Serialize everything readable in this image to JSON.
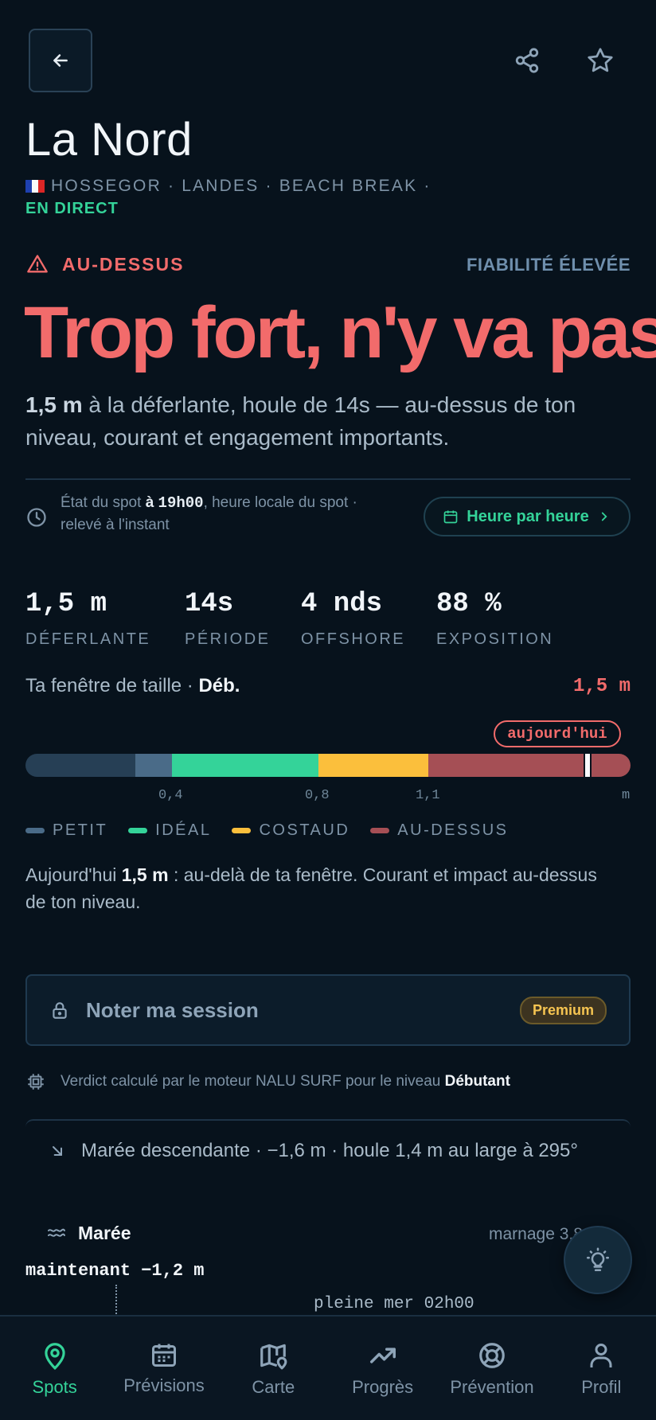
{
  "header": {
    "spot_name": "La Nord",
    "meta": "HOSSEGOR · LANDES · BEACH BREAK ·",
    "live": "EN DIRECT",
    "icons": [
      "arrow-left-icon",
      "share-icon",
      "star-icon"
    ]
  },
  "verdict": {
    "level_label": "AU-DESSUS",
    "reliability": "FIABILITÉ ÉLEVÉE",
    "headline": "Trop fort, n'y va pas",
    "summary_bold": "1,5 m",
    "summary_rest": " à la déferlante, houle de 14s — au-dessus de ton niveau, courant et engagement importants.",
    "color": "#f26b6b"
  },
  "state": {
    "prefix": "État du spot ",
    "at": "à ",
    "time": "19h00",
    "suffix": ", heure locale du spot · relevé à l'instant",
    "hour_button": "Heure par heure"
  },
  "stats": [
    {
      "value": "1,5 m",
      "label": "DÉFERLANTE"
    },
    {
      "value": "14s",
      "label": "PÉRIODE"
    },
    {
      "value": "4 nds",
      "label": "OFFSHORE"
    },
    {
      "value": "88 %",
      "label": "EXPOSITION"
    }
  ],
  "size_window": {
    "label": "Ta fenêtre de taille · ",
    "level": "Déb.",
    "value": "1,5 m",
    "today_badge": "aujourd'hui",
    "current_m": 1.5,
    "ticks": [
      "0,4",
      "0,8",
      "1,1",
      "m"
    ],
    "legend": [
      {
        "label": "PETIT",
        "color": "#4a6b88"
      },
      {
        "label": "IDÉAL",
        "color": "#34d399"
      },
      {
        "label": "COSTAUD",
        "color": "#fbbf3c"
      },
      {
        "label": "AU-DESSUS",
        "color": "#a54f55"
      }
    ],
    "note_prefix": "Aujourd'hui ",
    "note_bold": "1,5 m",
    "note_rest": " : au-delà de ta fenêtre. Courant et impact au-dessus de ton niveau."
  },
  "session": {
    "label": "Noter ma session",
    "badge": "Premium"
  },
  "engine": {
    "text": "Verdict calculé par le moteur NALU SURF pour le niveau ",
    "level": "Débutant"
  },
  "tide": {
    "line": "Marée descendante · −1,6 m · houle 1,4 m au large à 295°",
    "title": "Marée",
    "marnage": "marnage 3,8",
    "now": "maintenant −1,2 m",
    "high": "pleine mer 02h00"
  },
  "nav": [
    {
      "label": "Spots",
      "icon": "map-pin-icon",
      "active": true
    },
    {
      "label": "Prévisions",
      "icon": "calendar-icon",
      "active": false
    },
    {
      "label": "Carte",
      "icon": "map-icon",
      "active": false
    },
    {
      "label": "Progrès",
      "icon": "trending-up-icon",
      "active": false
    },
    {
      "label": "Prévention",
      "icon": "lifebuoy-icon",
      "active": false
    },
    {
      "label": "Profil",
      "icon": "user-icon",
      "active": false
    }
  ]
}
